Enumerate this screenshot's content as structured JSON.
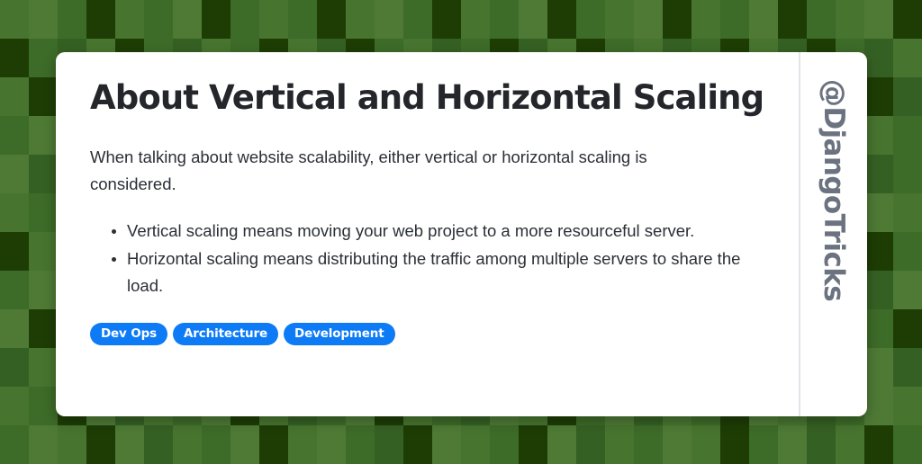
{
  "card": {
    "title": "About Vertical and Horizontal Scaling",
    "intro": "When talking about website scalability, either vertical or horizontal scaling is considered.",
    "bullets": [
      "Vertical scaling means moving your web project to a more resourceful server.",
      "Horizontal scaling means distributing the traffic among multiple servers to share the load."
    ],
    "tags": [
      {
        "label": "Dev Ops"
      },
      {
        "label": "Architecture"
      },
      {
        "label": "Development"
      }
    ],
    "watermark": "@DjangoTricks"
  },
  "colors": {
    "tag_background": "#0d7bf5",
    "tag_text": "#ffffff",
    "title_text": "#24262b",
    "body_text": "#2b2f36",
    "watermark_text": "#6b7280",
    "card_background": "#ffffff",
    "divider": "#e4e4ea"
  },
  "background": {
    "style": "green-checkerboard-mosaic",
    "palette": [
      "#1d3d05",
      "#2b5418",
      "#356023",
      "#3d6b28",
      "#47742f",
      "#4e7a35",
      "#2f5a1d",
      "#3a6726"
    ],
    "tiles": [
      [
        4,
        5,
        3,
        0,
        4,
        3,
        5,
        0,
        3,
        4,
        3,
        0,
        4,
        5,
        3,
        0,
        4,
        3,
        5,
        0,
        3,
        4,
        5,
        0,
        4,
        3,
        5,
        0,
        3,
        4,
        5,
        0
      ],
      [
        0,
        3,
        2,
        4,
        0,
        3,
        2,
        4,
        3,
        0,
        4,
        2,
        0,
        3,
        4,
        2,
        3,
        0,
        2,
        4,
        0,
        3,
        4,
        2,
        3,
        0,
        4,
        2,
        0,
        3,
        2,
        4
      ],
      [
        4,
        0,
        3,
        5,
        4,
        2,
        0,
        3,
        5,
        4,
        3,
        0,
        2,
        5,
        4,
        3,
        0,
        5,
        3,
        2,
        4,
        0,
        5,
        3,
        4,
        2,
        0,
        5,
        3,
        4,
        0,
        2
      ],
      [
        3,
        5,
        0,
        2,
        4,
        5,
        3,
        0,
        2,
        5,
        4,
        3,
        0,
        5,
        2,
        4,
        3,
        5,
        0,
        2,
        4,
        3,
        5,
        0,
        2,
        4,
        3,
        0,
        5,
        2,
        4,
        3
      ],
      [
        5,
        2,
        4,
        3,
        0,
        4,
        5,
        2,
        3,
        4,
        0,
        5,
        3,
        2,
        4,
        5,
        0,
        3,
        4,
        2,
        5,
        0,
        3,
        4,
        2,
        5,
        3,
        4,
        0,
        5,
        2,
        3
      ],
      [
        4,
        3,
        5,
        0,
        3,
        2,
        4,
        5,
        0,
        3,
        5,
        2,
        4,
        0,
        3,
        5,
        2,
        4,
        0,
        5,
        3,
        2,
        4,
        0,
        5,
        3,
        4,
        2,
        3,
        0,
        5,
        4
      ],
      [
        0,
        4,
        2,
        5,
        4,
        0,
        3,
        4,
        5,
        2,
        3,
        4,
        0,
        5,
        4,
        2,
        3,
        0,
        5,
        4,
        2,
        3,
        5,
        4,
        0,
        2,
        5,
        3,
        4,
        5,
        0,
        3
      ],
      [
        3,
        5,
        4,
        2,
        0,
        5,
        4,
        3,
        2,
        5,
        0,
        4,
        3,
        5,
        2,
        0,
        4,
        3,
        5,
        2,
        4,
        0,
        3,
        5,
        2,
        4,
        0,
        3,
        5,
        4,
        2,
        5
      ],
      [
        5,
        0,
        3,
        4,
        5,
        3,
        0,
        2,
        4,
        3,
        5,
        0,
        2,
        4,
        3,
        5,
        0,
        4,
        2,
        3,
        5,
        4,
        0,
        2,
        3,
        5,
        4,
        0,
        2,
        4,
        3,
        0
      ],
      [
        2,
        4,
        5,
        3,
        4,
        0,
        5,
        3,
        4,
        2,
        0,
        5,
        4,
        3,
        2,
        4,
        5,
        0,
        3,
        4,
        2,
        5,
        3,
        0,
        4,
        5,
        2,
        3,
        4,
        0,
        5,
        2
      ],
      [
        4,
        3,
        0,
        5,
        2,
        4,
        3,
        5,
        0,
        4,
        2,
        3,
        5,
        0,
        4,
        3,
        2,
        5,
        4,
        0,
        3,
        5,
        2,
        4,
        3,
        0,
        5,
        4,
        2,
        3,
        5,
        4
      ],
      [
        3,
        5,
        4,
        0,
        5,
        2,
        4,
        3,
        5,
        0,
        4,
        5,
        3,
        2,
        0,
        5,
        4,
        3,
        0,
        5,
        2,
        4,
        3,
        5,
        4,
        0,
        3,
        5,
        2,
        4,
        0,
        3
      ]
    ]
  }
}
